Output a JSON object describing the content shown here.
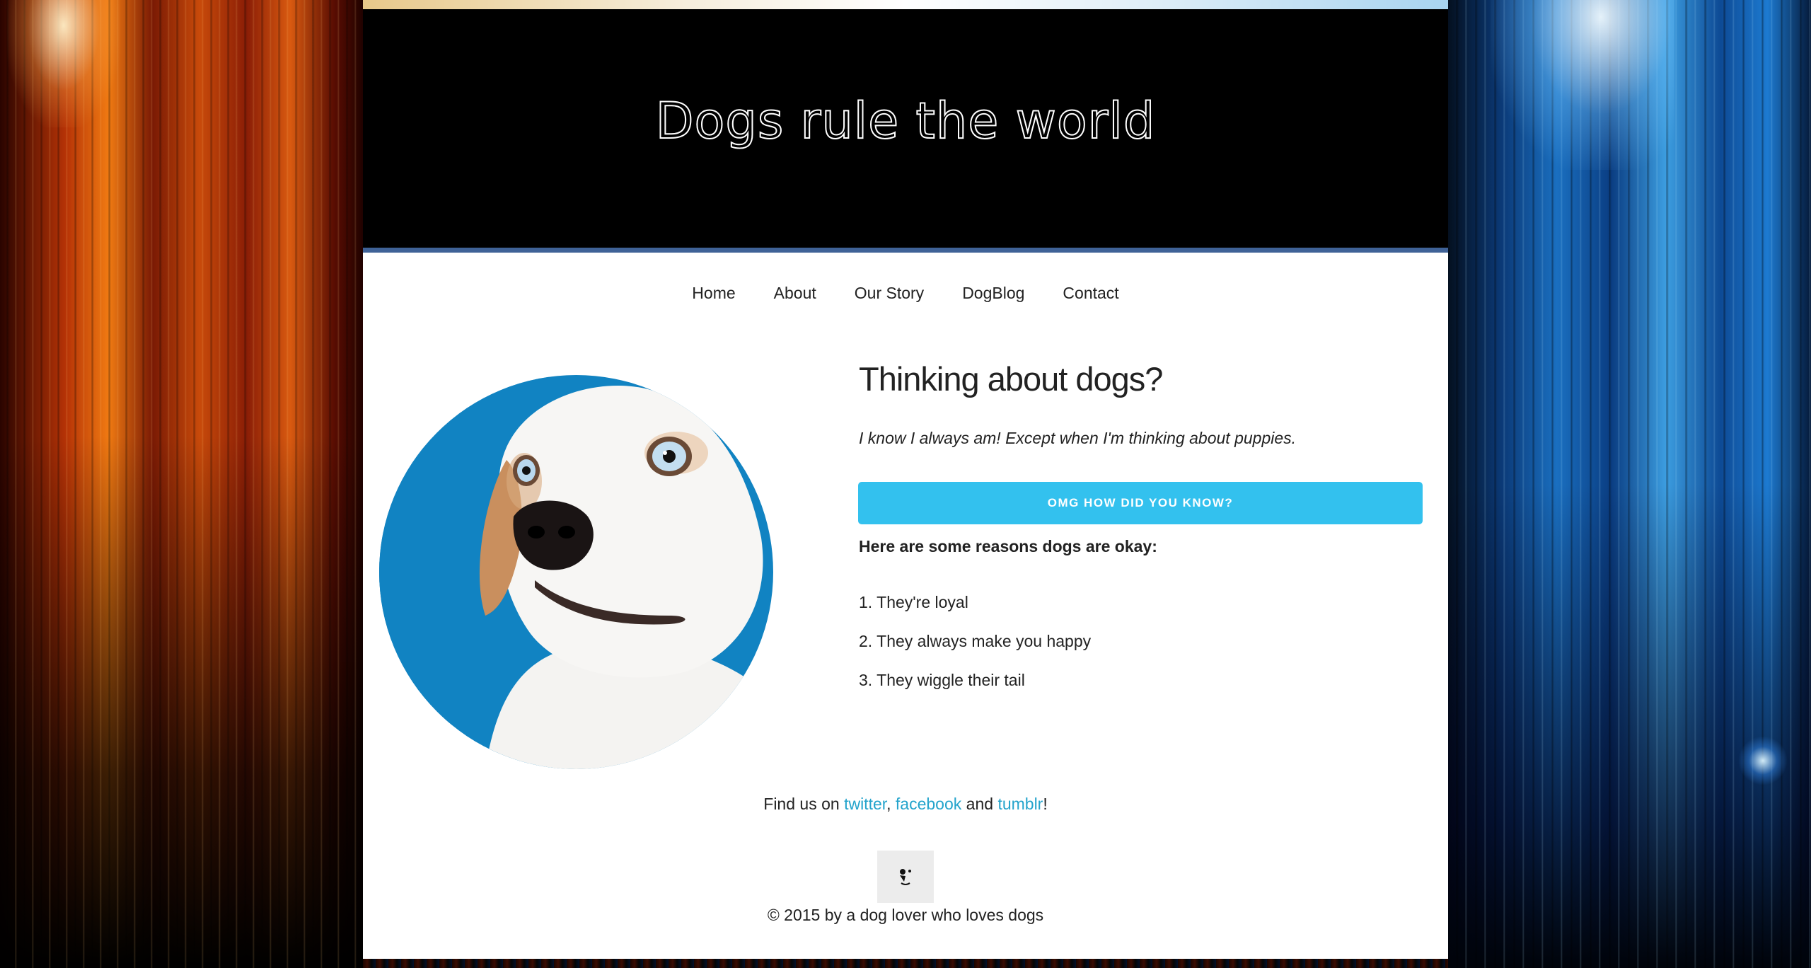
{
  "site": {
    "title": "Dogs rule the world"
  },
  "nav": {
    "items": [
      "Home",
      "About",
      "Our Story",
      "DogBlog",
      "Contact"
    ]
  },
  "main": {
    "heading": "Thinking about dogs?",
    "tagline": "I know I always am! Except when I'm thinking about puppies.",
    "cta_label": "OMG HOW DID YOU KNOW?",
    "reasons_title": "Here are some reasons dogs are okay:",
    "reasons": [
      "1. They're loyal",
      "2. They always make you happy",
      "3. They wiggle their tail"
    ]
  },
  "footer": {
    "social_prefix": "Find us on ",
    "twitter": "twitter",
    "sep1": ", ",
    "facebook": "facebook",
    "sep2": " and ",
    "tumblr": "tumblr",
    "social_suffix": "!",
    "copyright": "© 2015 by a dog lover who loves dogs"
  },
  "colors": {
    "header_bg": "#000000",
    "header_border": "#3f6297",
    "button": "#33c1ee",
    "link": "#24a4cc"
  },
  "icons": {
    "footer_logo": "dog-face-icon",
    "hero_image": "dog-photo"
  }
}
